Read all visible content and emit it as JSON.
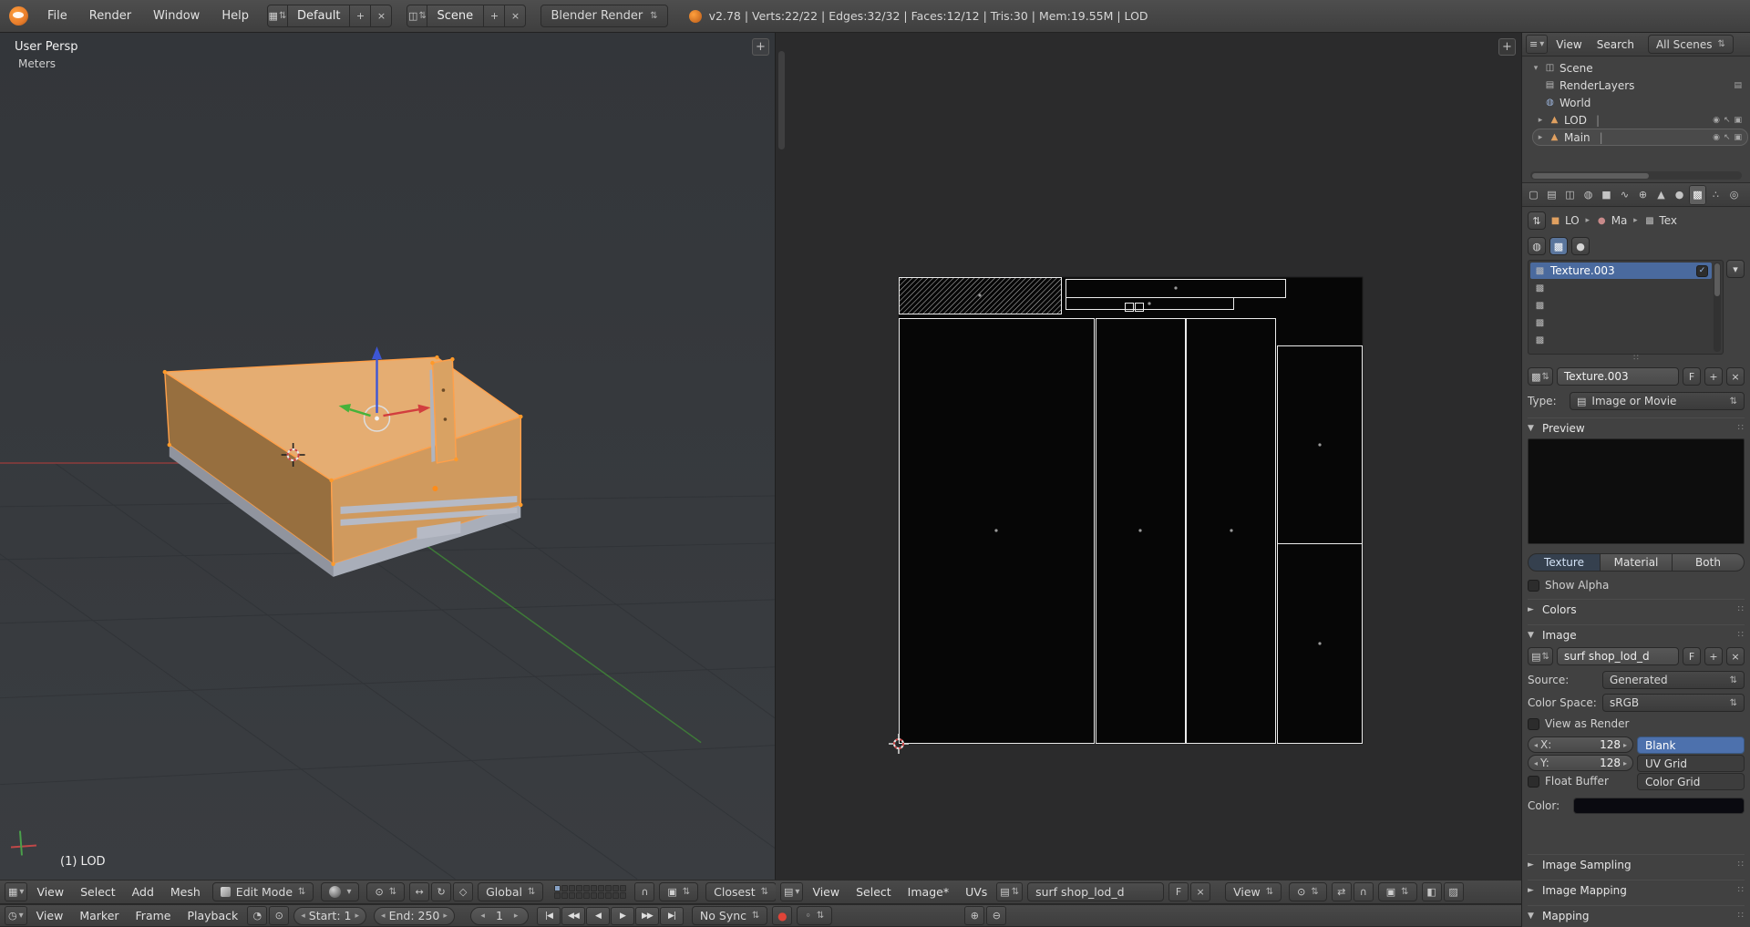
{
  "icons": {
    "updown": "⇅",
    "down": "▾",
    "right_small": "▸",
    "left_small": "◂",
    "close": "×",
    "plus": "+",
    "check": "✓",
    "panel_open": "▼",
    "panel_closed": "►",
    "drag_dots": "∷",
    "checker": "▩",
    "image": "▤",
    "scene": "◫",
    "world": "◍",
    "object": "■",
    "mesh": "▲",
    "material": "●",
    "outliner_list": "≡",
    "eye": "◉",
    "pointer": "↖",
    "camera": "▣",
    "vline": "|",
    "clock": "◷",
    "magnet": "∩",
    "pivot": "⊙",
    "sync": "⇄",
    "grid_editor": "▦",
    "manip_translate": "↔",
    "manip_rotate": "↻",
    "manip_scale": "◇",
    "shading_a": "◧",
    "shading_b": "◨",
    "shading_c": "▨",
    "preview_range": "◔",
    "lock_time": "⊙",
    "jump_first": "|◀",
    "prev_key": "◀◀",
    "play_rev": "◀",
    "play": "▶",
    "next_key": "▶▶",
    "jump_last": "▶|",
    "record": "●",
    "key_dot": "◦",
    "key_add": "⊕",
    "key_del": "⊖"
  },
  "colors": {
    "selection_blue": "#4d71ad",
    "edit_mode_orange": "#ffa04a",
    "header_gray": "#454545"
  },
  "topbar": {
    "menus": [
      "File",
      "Render",
      "Window",
      "Help"
    ],
    "layout_value": "Default",
    "scene_value": "Scene",
    "engine_value": "Blender Render",
    "stats": "v2.78 | Verts:22/22 | Edges:32/32 | Faces:12/12 | Tris:30 | Mem:19.55M | LOD"
  },
  "viewport": {
    "view_label": "User Persp",
    "units_label": "Meters",
    "active_object_label": "(1) LOD",
    "header": {
      "menus": [
        "View",
        "Select",
        "Add",
        "Mesh"
      ],
      "mode": "Edit Mode",
      "orientation": "Global",
      "snap_target": "Closest"
    }
  },
  "uv_editor": {
    "header": {
      "menus": [
        "View",
        "Select",
        "Image*",
        "UVs"
      ],
      "image_name": "surf shop_lod_d",
      "fake_user_label": "F",
      "view_mode": "View"
    }
  },
  "outliner": {
    "header": {
      "menu_view": "View",
      "menu_search": "Search",
      "filter": "All Scenes"
    },
    "items": [
      {
        "label": "Scene"
      },
      {
        "label": "RenderLayers"
      },
      {
        "label": "World"
      },
      {
        "label": "LOD"
      },
      {
        "label": "Main"
      }
    ]
  },
  "properties": {
    "tab_icons": [
      "▢",
      "▤",
      "◫",
      "◍",
      "■",
      "∿",
      "⊕",
      "▲",
      "●",
      "▩",
      "∴",
      "◎"
    ],
    "breadcrumb": {
      "object": "LO",
      "material": "Ma",
      "texture": "Tex"
    },
    "slot_name": "Texture.003",
    "name_field": "Texture.003",
    "fake_user_label": "F",
    "type_label": "Type:",
    "type_value": "Image or Movie",
    "panels": {
      "preview": "Preview",
      "colors": "Colors",
      "image": "Image",
      "image_sampling": "Image Sampling",
      "image_mapping": "Image Mapping",
      "mapping": "Mapping"
    },
    "preview_toggle": [
      "Texture",
      "Material",
      "Both"
    ],
    "show_alpha_label": "Show Alpha",
    "image": {
      "name": "surf shop_lod_d",
      "fake_user_label": "F",
      "source_label": "Source:",
      "source_value": "Generated",
      "colorspace_label": "Color Space:",
      "colorspace_value": "sRGB",
      "view_as_render_label": "View as Render",
      "x_label": "X:",
      "x_value": "128",
      "y_label": "Y:",
      "y_value": "128",
      "generated_types": [
        "Blank",
        "UV Grid",
        "Color Grid"
      ],
      "float_buffer_label": "Float Buffer",
      "color_label": "Color:"
    }
  },
  "timeline": {
    "menus": [
      "View",
      "Marker",
      "Frame",
      "Playback"
    ],
    "start_label": "Start:",
    "start_value": "1",
    "end_label": "End:",
    "end_value": "250",
    "current_frame": "1",
    "sync_mode": "No Sync"
  }
}
